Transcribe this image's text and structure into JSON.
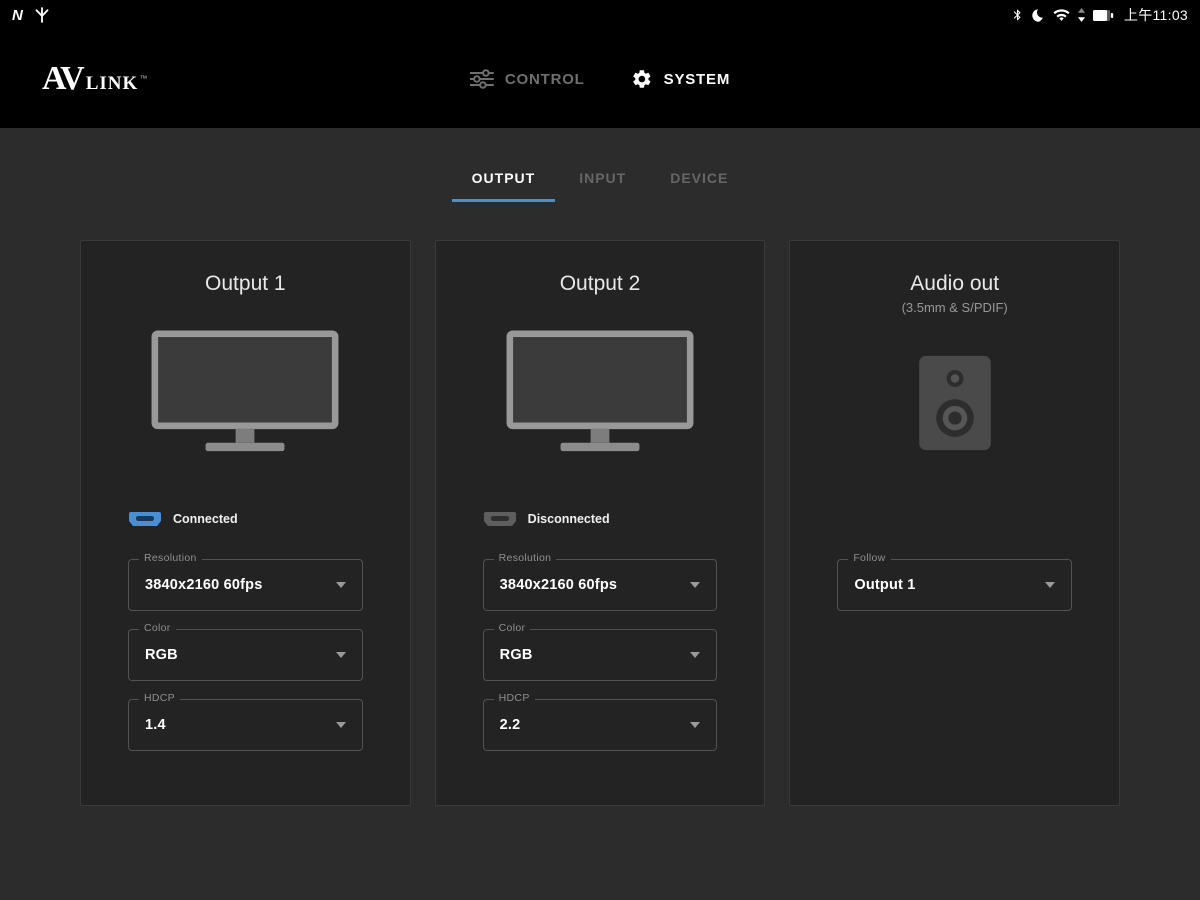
{
  "status_bar": {
    "nfc_label": "N",
    "time": "上午11:03",
    "icons_left": [
      "nfc-icon",
      "trident-icon"
    ],
    "icons_right": [
      "bluetooth-icon",
      "moon-icon",
      "wifi-icon",
      "network-arrows-icon",
      "battery-icon"
    ]
  },
  "header": {
    "logo": {
      "av": "AV",
      "link": "LINK",
      "tm": "™"
    },
    "nav_control": "CONTROL",
    "nav_system": "SYSTEM"
  },
  "tabs": {
    "output": "OUTPUT",
    "input": "INPUT",
    "device": "DEVICE"
  },
  "cards": [
    {
      "title": "Output 1",
      "status": "Connected",
      "fields": [
        {
          "label": "Resolution",
          "value": "3840x2160 60fps"
        },
        {
          "label": "Color",
          "value": "RGB"
        },
        {
          "label": "HDCP",
          "value": "1.4"
        }
      ]
    },
    {
      "title": "Output 2",
      "status": "Disconnected",
      "fields": [
        {
          "label": "Resolution",
          "value": "3840x2160 60fps"
        },
        {
          "label": "Color",
          "value": "RGB"
        },
        {
          "label": "HDCP",
          "value": "2.2"
        }
      ]
    },
    {
      "title": "Audio out",
      "subtitle": "(3.5mm & S/PDIF)",
      "fields": [
        {
          "label": "Follow",
          "value": "Output 1"
        }
      ]
    }
  ],
  "colors": {
    "accent_blue": "#4a8fd4",
    "tab_underline": "#4d8fcc",
    "background": "#2c2c2c",
    "card_background": "#232323"
  }
}
